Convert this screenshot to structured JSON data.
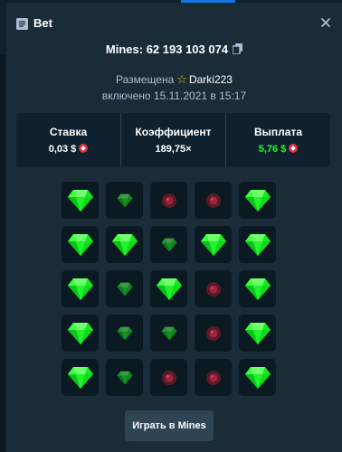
{
  "modal": {
    "title": "Bet",
    "icon": "bet-receipt-icon",
    "close_icon": "close-icon"
  },
  "game": {
    "title": "Mines: 62 193 103 074",
    "copy_icon": "copy-icon"
  },
  "meta": {
    "placed_by_label": "Размещена",
    "user_icon": "vip-star-icon",
    "username": "Darki223",
    "date_text": "включено 15.11.2021 в 15:17"
  },
  "stats": {
    "bet_label": "Ставка",
    "bet_value": "0,03 $",
    "multiplier_label": "Коэффициент",
    "multiplier_value": "189,75×",
    "payout_label": "Выплата",
    "payout_value": "5,76 $",
    "currency_icon": "coin-icon"
  },
  "board": {
    "tiles": [
      "gem",
      "gem-dim",
      "mine-dim",
      "mine-dim",
      "gem",
      "gem",
      "gem",
      "gem-dim",
      "gem",
      "gem",
      "gem",
      "gem-dim",
      "gem",
      "mine-dim",
      "gem",
      "gem",
      "gem-dim",
      "gem-dim",
      "mine-dim",
      "gem",
      "gem",
      "gem-dim",
      "mine-dim",
      "mine-dim",
      "gem"
    ]
  },
  "actions": {
    "play_label": "Играть в Mines"
  },
  "colors": {
    "background": "#0f212e",
    "modal": "#1a2c38",
    "tile": "#0b1922",
    "gem": "#1fff20",
    "mine": "#e03148",
    "payout": "#1fff20",
    "button": "#2f4553"
  }
}
